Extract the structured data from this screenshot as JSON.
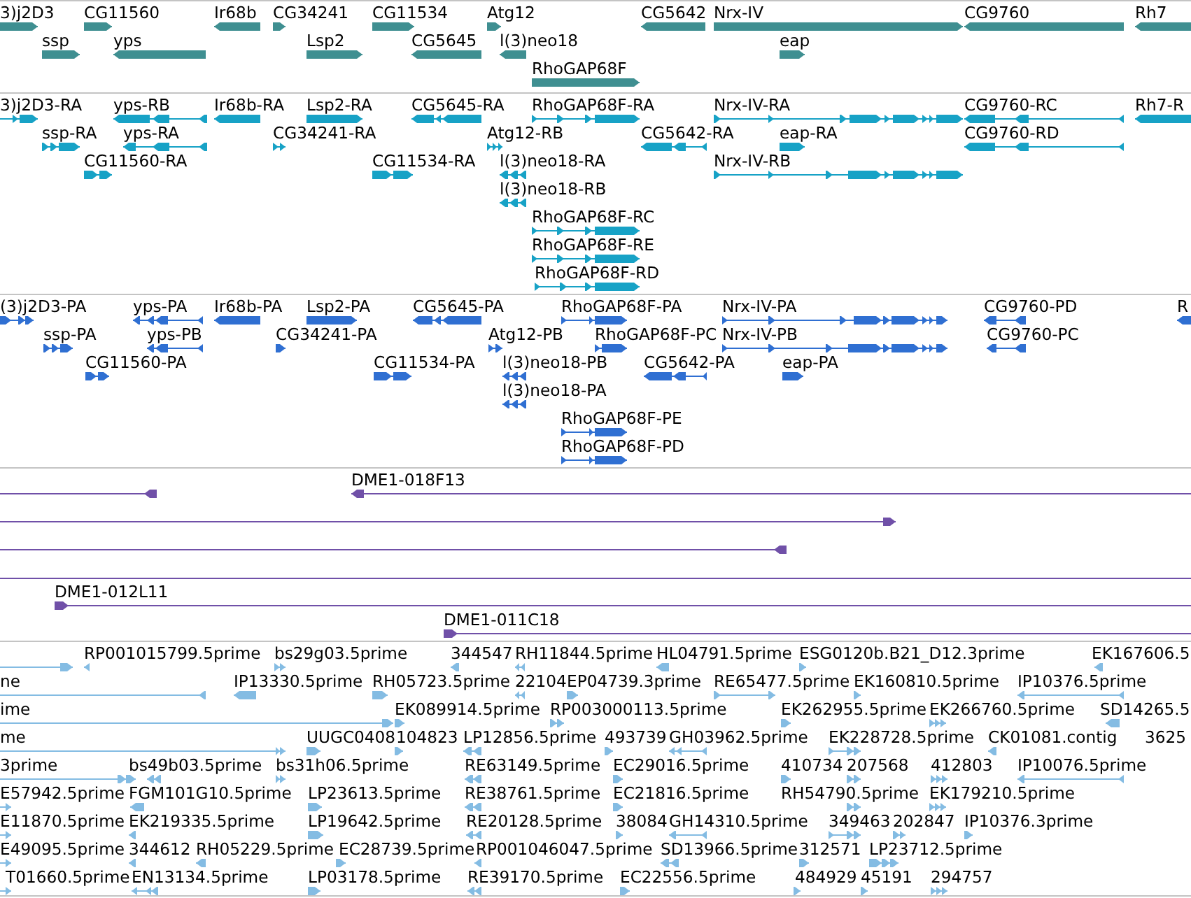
{
  "tracks": [
    {
      "kind": "gene",
      "features": [
        {
          "label": "3)j2D3",
          "reverse": false
        },
        {
          "label": "CG11560",
          "reverse": false
        },
        {
          "label": "Ir68b",
          "reverse": true
        },
        {
          "label": "CG34241",
          "reverse": false
        },
        {
          "label": "CG11534",
          "reverse": false
        },
        {
          "label": "Atg12",
          "reverse": false
        },
        {
          "label": "CG5642",
          "reverse": true
        },
        {
          "label": "Nrx-IV",
          "reverse": false
        },
        {
          "label": "CG9760",
          "reverse": true
        },
        {
          "label": "Rh7",
          "reverse": true
        },
        {
          "label": "ssp",
          "reverse": false
        },
        {
          "label": "yps",
          "reverse": true
        },
        {
          "label": "Lsp2",
          "reverse": false
        },
        {
          "label": "CG5645",
          "reverse": true
        },
        {
          "label": "l(3)neo18",
          "reverse": true
        },
        {
          "label": "eap",
          "reverse": false
        },
        {
          "label": "RhoGAP68F",
          "reverse": false
        }
      ]
    },
    {
      "kind": "transcript",
      "features": [
        {
          "label": "3)j2D3-RA",
          "reverse": false
        },
        {
          "label": "yps-RB",
          "reverse": true
        },
        {
          "label": "Ir68b-RA",
          "reverse": true
        },
        {
          "label": "Lsp2-RA",
          "reverse": false
        },
        {
          "label": "CG5645-RA",
          "reverse": true
        },
        {
          "label": "RhoGAP68F-RA",
          "reverse": false
        },
        {
          "label": "Nrx-IV-RA",
          "reverse": false
        },
        {
          "label": "CG9760-RC",
          "reverse": true
        },
        {
          "label": "Rh7-R",
          "reverse": true
        },
        {
          "label": "ssp-RA",
          "reverse": false
        },
        {
          "label": "yps-RA",
          "reverse": true
        },
        {
          "label": "CG34241-RA",
          "reverse": false
        },
        {
          "label": "Atg12-RB",
          "reverse": false
        },
        {
          "label": "CG5642-RA",
          "reverse": true
        },
        {
          "label": "eap-RA",
          "reverse": false
        },
        {
          "label": "CG9760-RD",
          "reverse": true
        },
        {
          "label": "CG11560-RA",
          "reverse": false
        },
        {
          "label": "CG11534-RA",
          "reverse": false
        },
        {
          "label": "l(3)neo18-RA",
          "reverse": true
        },
        {
          "label": "Nrx-IV-RB",
          "reverse": false
        },
        {
          "label": "l(3)neo18-RB",
          "reverse": true
        },
        {
          "label": "RhoGAP68F-RC",
          "reverse": false
        },
        {
          "label": "RhoGAP68F-RE",
          "reverse": false
        },
        {
          "label": "RhoGAP68F-RD",
          "reverse": false
        }
      ]
    },
    {
      "kind": "protein",
      "features": [
        {
          "label": "(3)j2D3-PA",
          "reverse": false
        },
        {
          "label": "yps-PA",
          "reverse": true
        },
        {
          "label": "Ir68b-PA",
          "reverse": true
        },
        {
          "label": "Lsp2-PA",
          "reverse": false
        },
        {
          "label": "CG5645-PA",
          "reverse": true
        },
        {
          "label": "RhoGAP68F-PA",
          "reverse": false
        },
        {
          "label": "Nrx-IV-PA",
          "reverse": false
        },
        {
          "label": "CG9760-PD",
          "reverse": true
        },
        {
          "label": "R",
          "reverse": true
        },
        {
          "label": "ssp-PA",
          "reverse": false
        },
        {
          "label": "yps-PB",
          "reverse": true
        },
        {
          "label": "CG34241-PA",
          "reverse": false
        },
        {
          "label": "Atg12-PB",
          "reverse": false
        },
        {
          "label": "RhoGAP68F-PC",
          "reverse": false
        },
        {
          "label": "Nrx-IV-PB",
          "reverse": false
        },
        {
          "label": "CG9760-PC",
          "reverse": true
        },
        {
          "label": "CG11560-PA",
          "reverse": false
        },
        {
          "label": "CG11534-PA",
          "reverse": false
        },
        {
          "label": "l(3)neo18-PB",
          "reverse": true
        },
        {
          "label": "CG5642-PA",
          "reverse": true
        },
        {
          "label": "eap-PA",
          "reverse": false
        },
        {
          "label": "l(3)neo18-PA",
          "reverse": true
        },
        {
          "label": "RhoGAP68F-PE",
          "reverse": false
        },
        {
          "label": "RhoGAP68F-PD",
          "reverse": false
        }
      ]
    },
    {
      "kind": "clone",
      "features": [
        {
          "reverse": true
        },
        {
          "label": "DME1-018F13",
          "reverse": true
        },
        {
          "reverse": false
        },
        {
          "reverse": true
        },
        {
          "arrowhead": false
        },
        {
          "label": "DME1-012L11",
          "reverse": false
        },
        {
          "label": "DME1-011C18",
          "reverse": false
        }
      ]
    },
    {
      "kind": "est",
      "features": [
        {
          "reverse": false
        },
        {
          "label": "RP001015799.5prime",
          "reverse": true
        },
        {
          "label": "bs29g03.5prime",
          "reverse": false
        },
        {
          "label": "344547",
          "reverse": true
        },
        {
          "label": "RH11844.5prime",
          "reverse": true
        },
        {
          "label": "HL04791.5prime",
          "reverse": true
        },
        {
          "label": "ESG0120b.B21_D12.3prime",
          "reverse": false
        },
        {
          "label": "EK167606.5",
          "reverse": true
        },
        {
          "label": "ne",
          "reverse": true
        },
        {
          "label": "IP13330.5prime",
          "reverse": true
        },
        {
          "label": "RH05723.5prime",
          "reverse": false
        },
        {
          "label": "22104",
          "reverse": true
        },
        {
          "label": "EP04739.3prime",
          "reverse": false
        },
        {
          "label": "RE65477.5prime",
          "reverse": false
        },
        {
          "label": "EK160810.5prime",
          "reverse": false
        },
        {
          "label": "IP10376.5prime",
          "reverse": true
        },
        {
          "label": "ime",
          "reverse": false
        },
        {
          "label": "EK089914.5prime",
          "reverse": false
        },
        {
          "label": "RP003000113.5prime",
          "reverse": false
        },
        {
          "label": "EK262955.5prime",
          "reverse": false
        },
        {
          "label": "EK266760.5prime",
          "reverse": false
        },
        {
          "label": "SD14265.5",
          "reverse": true
        },
        {
          "label": "me",
          "reverse": false
        },
        {
          "label": "UUGC0408",
          "reverse": false
        },
        {
          "label": "104823",
          "reverse": false
        },
        {
          "label": "LP12856.5prime",
          "reverse": true
        },
        {
          "label": "493739",
          "reverse": false
        },
        {
          "label": "GH03962.5prime",
          "reverse": true
        },
        {
          "label": "EK228728.5prime",
          "reverse": false
        },
        {
          "label": "CK01081.contig",
          "reverse": true
        },
        {
          "label": "3625"
        },
        {
          "label": "3prime",
          "reverse": false
        },
        {
          "label": "bs49b03.5prime",
          "reverse": true
        },
        {
          "label": "bs31h06.5prime",
          "reverse": false
        },
        {
          "label": "RE63149.5prime",
          "reverse": true
        },
        {
          "label": "EC29016.5prime",
          "reverse": false
        },
        {
          "label": "410734",
          "reverse": false
        },
        {
          "label": "207568",
          "reverse": false
        },
        {
          "label": "412803",
          "reverse": false
        },
        {
          "label": "IP10076.5prime",
          "reverse": true
        },
        {
          "label": "E57942.5prime",
          "reverse": false
        },
        {
          "label": "FGM101G10.5prime",
          "reverse": true
        },
        {
          "label": "LP23613.5prime",
          "reverse": false
        },
        {
          "label": "RE38761.5prime",
          "reverse": true
        },
        {
          "label": "EC21816.5prime",
          "reverse": false
        },
        {
          "label": "RH54790.5prime",
          "reverse": false
        },
        {
          "label": "EK179210.5prime",
          "reverse": false
        },
        {
          "label": "E11870.5prime",
          "reverse": false
        },
        {
          "label": "EK219335.5prime",
          "reverse": true
        },
        {
          "label": "LP19642.5prime",
          "reverse": false
        },
        {
          "label": "RE20128.5prime",
          "reverse": true
        },
        {
          "label": "38084",
          "reverse": false
        },
        {
          "label": "GH14310.5prime",
          "reverse": true
        },
        {
          "label": "349463",
          "reverse": false
        },
        {
          "label": "202847",
          "reverse": false
        },
        {
          "label": "IP10376.3prime",
          "reverse": false
        },
        {
          "label": "E49095.5prime",
          "reverse": false
        },
        {
          "label": "344612",
          "reverse": true
        },
        {
          "label": "RH05229.5prime",
          "reverse": true
        },
        {
          "label": "EC28739.5prime",
          "reverse": false
        },
        {
          "label": "RP001046047.5prime",
          "reverse": true
        },
        {
          "label": "SD13966.5prime",
          "reverse": true
        },
        {
          "label": "312571",
          "reverse": false
        },
        {
          "label": "LP23712.5prime",
          "reverse": false
        },
        {
          "label": "T01660.5prime",
          "reverse": false
        },
        {
          "label": "EN13134.5prime",
          "reverse": true
        },
        {
          "label": "LP03178.5prime",
          "reverse": false
        },
        {
          "label": "RE39170.5prime",
          "reverse": true
        },
        {
          "label": "EC22556.5prime",
          "reverse": false
        },
        {
          "label": "484929",
          "reverse": false
        },
        {
          "label": "45191",
          "reverse": false
        },
        {
          "label": "294757",
          "reverse": false
        }
      ]
    }
  ]
}
